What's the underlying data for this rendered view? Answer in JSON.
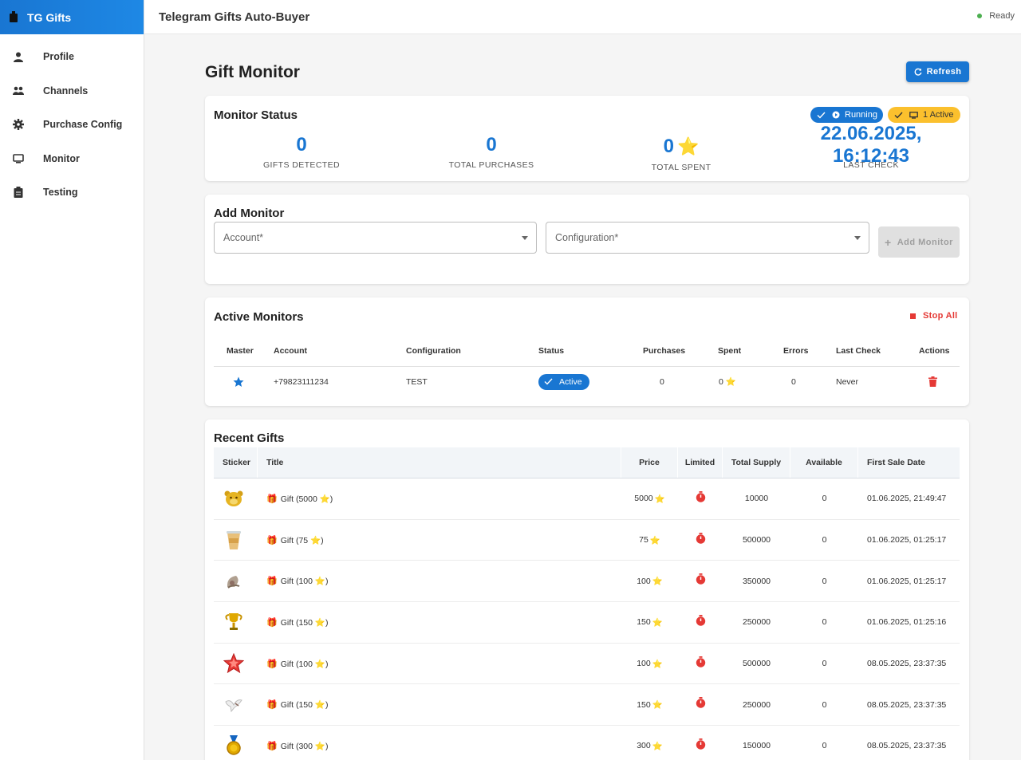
{
  "sidebar": {
    "brand": "TG Gifts",
    "items": [
      {
        "label": "Profile",
        "icon": "person-icon"
      },
      {
        "label": "Channels",
        "icon": "people-icon"
      },
      {
        "label": "Purchase Config",
        "icon": "gear-icon"
      },
      {
        "label": "Monitor",
        "icon": "monitor-icon"
      },
      {
        "label": "Testing",
        "icon": "clipboard-icon"
      }
    ]
  },
  "header": {
    "title": "Telegram Gifts Auto-Buyer",
    "status": "Ready"
  },
  "page": {
    "title": "Gift Monitor",
    "refresh_label": "Refresh"
  },
  "monitor_status": {
    "title": "Monitor Status",
    "running_chip": "Running",
    "active_chip": "1 Active",
    "stats": {
      "gifts_detected": "0",
      "gifts_detected_label": "GIFTS DETECTED",
      "total_purchases": "0",
      "total_purchases_label": "TOTAL PURCHASES",
      "total_spent": "0",
      "total_spent_label": "TOTAL SPENT",
      "last_check": "22.06.2025, 16:12:43",
      "last_check_label": "LAST CHECK"
    }
  },
  "add_monitor": {
    "title": "Add Monitor",
    "account_placeholder": "Account*",
    "configuration_placeholder": "Configuration*",
    "button_label": "Add Monitor"
  },
  "active_monitors": {
    "title": "Active Monitors",
    "stop_all_label": "Stop All",
    "columns": [
      "Master",
      "Account",
      "Configuration",
      "Status",
      "Purchases",
      "Spent",
      "Errors",
      "Last Check",
      "Actions"
    ],
    "rows": [
      {
        "account": "+79823111234",
        "configuration": "TEST",
        "status": "Active",
        "purchases": "0",
        "spent": "0",
        "errors": "0",
        "last_check": "Never"
      }
    ]
  },
  "recent_gifts": {
    "title": "Recent Gifts",
    "columns": [
      "Sticker",
      "Title",
      "Price",
      "Limited",
      "Total Supply",
      "Available",
      "First Sale Date"
    ],
    "rows": [
      {
        "sticker": "bear-sticker",
        "title": "Gift (5000 ⭐)",
        "price": "5000",
        "total_supply": "10000",
        "available": "0",
        "first_sale": "01.06.2025, 21:49:47"
      },
      {
        "sticker": "cup-sticker",
        "title": "Gift (75 ⭐)",
        "price": "75",
        "total_supply": "500000",
        "available": "0",
        "first_sale": "01.06.2025, 01:25:17"
      },
      {
        "sticker": "shell-sticker",
        "title": "Gift (100 ⭐)",
        "price": "100",
        "total_supply": "350000",
        "available": "0",
        "first_sale": "01.06.2025, 01:25:17"
      },
      {
        "sticker": "trophy-sticker",
        "title": "Gift (150 ⭐)",
        "price": "150",
        "total_supply": "250000",
        "available": "0",
        "first_sale": "01.06.2025, 01:25:16"
      },
      {
        "sticker": "star-sticker",
        "title": "Gift (100 ⭐)",
        "price": "100",
        "total_supply": "500000",
        "available": "0",
        "first_sale": "08.05.2025, 23:37:35"
      },
      {
        "sticker": "bird-sticker",
        "title": "Gift (150 ⭐)",
        "price": "150",
        "total_supply": "250000",
        "available": "0",
        "first_sale": "08.05.2025, 23:37:35"
      },
      {
        "sticker": "medal-sticker",
        "title": "Gift (300 ⭐)",
        "price": "300",
        "total_supply": "150000",
        "available": "0",
        "first_sale": "08.05.2025, 23:37:35"
      }
    ]
  },
  "colors": {
    "primary": "#1976d2",
    "warning": "#fbc02d",
    "danger": "#e53935",
    "success": "#4caf50"
  }
}
